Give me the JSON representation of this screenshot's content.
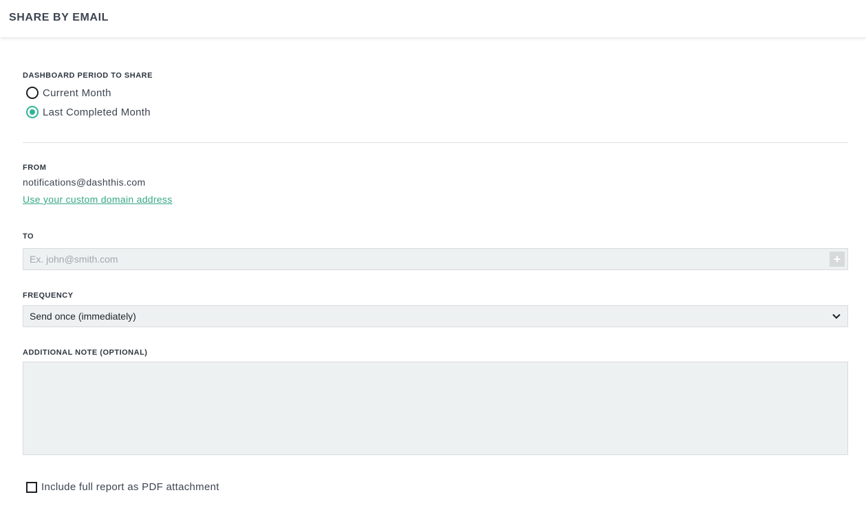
{
  "header": {
    "title": "SHARE BY EMAIL"
  },
  "period": {
    "label": "DASHBOARD PERIOD TO SHARE",
    "options": [
      {
        "label": "Current Month",
        "selected": false
      },
      {
        "label": "Last Completed Month",
        "selected": true
      }
    ]
  },
  "from": {
    "label": "FROM",
    "address": "notifications@dashthis.com",
    "custom_domain_link": "Use your custom domain address"
  },
  "to": {
    "label": "TO",
    "value": "",
    "placeholder": "Ex. john@smith.com",
    "add_icon": "plus-icon"
  },
  "frequency": {
    "label": "FREQUENCY",
    "selected": "Send once (immediately)",
    "icon": "chevron-down-icon"
  },
  "note": {
    "label": "ADDITIONAL NOTE (OPTIONAL)",
    "value": ""
  },
  "pdf_attachment": {
    "label": "Include full report as PDF attachment",
    "checked": false
  },
  "colors": {
    "accent": "#2fb596",
    "link": "#37a886",
    "field_bg": "#eef1f1",
    "text": "#3d4451"
  }
}
